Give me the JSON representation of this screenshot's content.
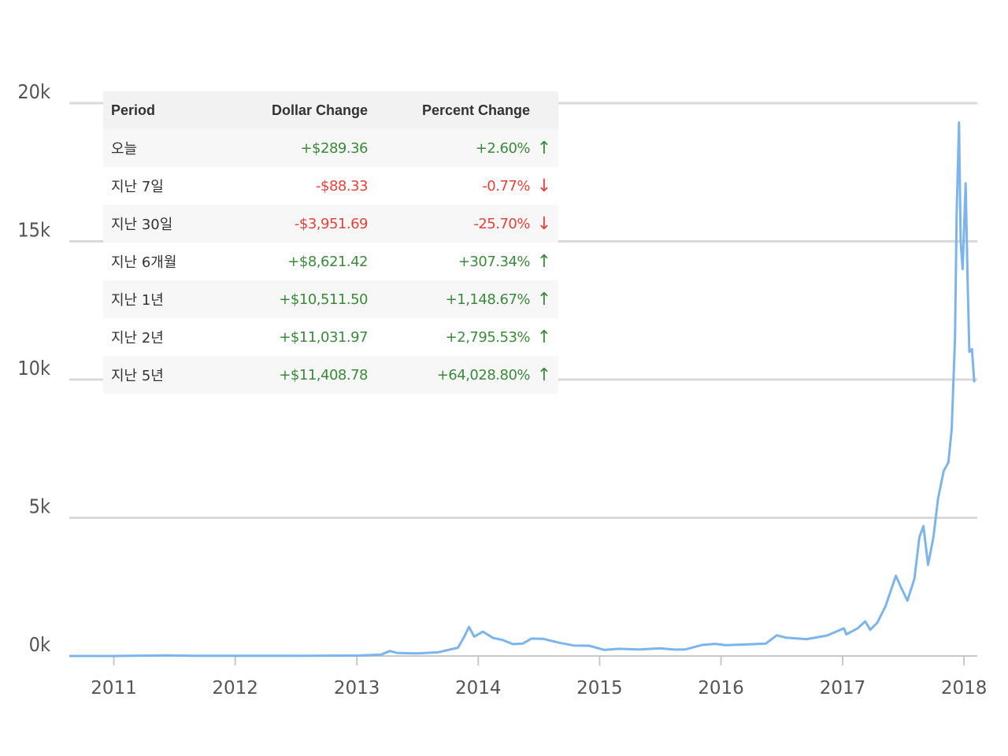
{
  "colors": {
    "line": "#7cb5ec",
    "grid": "#d9d9d9",
    "positive": "#3b8a3b",
    "negative": "#e8413a"
  },
  "chart_data": {
    "type": "line",
    "title": "",
    "xlabel": "",
    "ylabel": "",
    "x_ticks": [
      "2011",
      "2012",
      "2013",
      "2014",
      "2015",
      "2016",
      "2017",
      "2018"
    ],
    "y_ticks": [
      "0k",
      "5k",
      "10k",
      "15k",
      "20k"
    ],
    "xlim": [
      "2010-08-20",
      "2018-02-10"
    ],
    "ylim": [
      0,
      20000
    ],
    "grid": true,
    "series": [
      {
        "points": [
          [
            "2010-08-20",
            0
          ],
          [
            "2011-01-01",
            0.3
          ],
          [
            "2011-06-10",
            20
          ],
          [
            "2011-09-01",
            6
          ],
          [
            "2012-01-01",
            5
          ],
          [
            "2012-07-01",
            7
          ],
          [
            "2012-12-01",
            13
          ],
          [
            "2013-01-01",
            14
          ],
          [
            "2013-03-15",
            50
          ],
          [
            "2013-04-10",
            180
          ],
          [
            "2013-05-01",
            110
          ],
          [
            "2013-07-01",
            90
          ],
          [
            "2013-09-01",
            130
          ],
          [
            "2013-11-01",
            300
          ],
          [
            "2013-11-20",
            700
          ],
          [
            "2013-12-04",
            1050
          ],
          [
            "2013-12-20",
            700
          ],
          [
            "2014-01-15",
            880
          ],
          [
            "2014-02-15",
            650
          ],
          [
            "2014-03-15",
            580
          ],
          [
            "2014-04-15",
            430
          ],
          [
            "2014-05-15",
            450
          ],
          [
            "2014-06-10",
            630
          ],
          [
            "2014-07-15",
            620
          ],
          [
            "2014-09-01",
            480
          ],
          [
            "2014-10-15",
            380
          ],
          [
            "2014-12-01",
            370
          ],
          [
            "2015-01-15",
            220
          ],
          [
            "2015-03-01",
            260
          ],
          [
            "2015-05-01",
            235
          ],
          [
            "2015-07-01",
            280
          ],
          [
            "2015-08-15",
            230
          ],
          [
            "2015-09-15",
            235
          ],
          [
            "2015-11-05",
            400
          ],
          [
            "2015-12-15",
            440
          ],
          [
            "2016-01-15",
            390
          ],
          [
            "2016-03-15",
            415
          ],
          [
            "2016-05-15",
            450
          ],
          [
            "2016-06-17",
            750
          ],
          [
            "2016-07-15",
            660
          ],
          [
            "2016-09-15",
            610
          ],
          [
            "2016-11-15",
            740
          ],
          [
            "2017-01-05",
            1000
          ],
          [
            "2017-01-12",
            780
          ],
          [
            "2017-02-15",
            1000
          ],
          [
            "2017-03-10",
            1250
          ],
          [
            "2017-03-25",
            950
          ],
          [
            "2017-04-15",
            1200
          ],
          [
            "2017-05-10",
            1800
          ],
          [
            "2017-06-10",
            2900
          ],
          [
            "2017-06-25",
            2500
          ],
          [
            "2017-07-15",
            2000
          ],
          [
            "2017-08-05",
            2800
          ],
          [
            "2017-08-20",
            4300
          ],
          [
            "2017-09-01",
            4700
          ],
          [
            "2017-09-15",
            3300
          ],
          [
            "2017-10-01",
            4300
          ],
          [
            "2017-10-15",
            5700
          ],
          [
            "2017-11-01",
            6700
          ],
          [
            "2017-11-15",
            7000
          ],
          [
            "2017-11-25",
            8200
          ],
          [
            "2017-12-05",
            11500
          ],
          [
            "2017-12-10",
            16000
          ],
          [
            "2017-12-17",
            19300
          ],
          [
            "2017-12-22",
            15000
          ],
          [
            "2017-12-28",
            14000
          ],
          [
            "2018-01-06",
            17100
          ],
          [
            "2018-01-12",
            13500
          ],
          [
            "2018-01-17",
            11000
          ],
          [
            "2018-01-25",
            11100
          ],
          [
            "2018-02-01",
            9900
          ]
        ]
      }
    ]
  },
  "table": {
    "headers": {
      "period": "Period",
      "dollar": "Dollar Change",
      "percent": "Percent Change"
    },
    "rows": [
      {
        "period": "오늘",
        "dollar": "+$289.36",
        "percent": "+2.60%",
        "direction": "up"
      },
      {
        "period": "지난 7일",
        "dollar": "-$88.33",
        "percent": "-0.77%",
        "direction": "down"
      },
      {
        "period": "지난 30일",
        "dollar": "-$3,951.69",
        "percent": "-25.70%",
        "direction": "down"
      },
      {
        "period": "지난 6개월",
        "dollar": "+$8,621.42",
        "percent": "+307.34%",
        "direction": "up"
      },
      {
        "period": "지난 1년",
        "dollar": "+$10,511.50",
        "percent": "+1,148.67%",
        "direction": "up"
      },
      {
        "period": "지난 2년",
        "dollar": "+$11,031.97",
        "percent": "+2,795.53%",
        "direction": "up"
      },
      {
        "period": "지난 5년",
        "dollar": "+$11,408.78",
        "percent": "+64,028.80%",
        "direction": "up"
      }
    ]
  }
}
